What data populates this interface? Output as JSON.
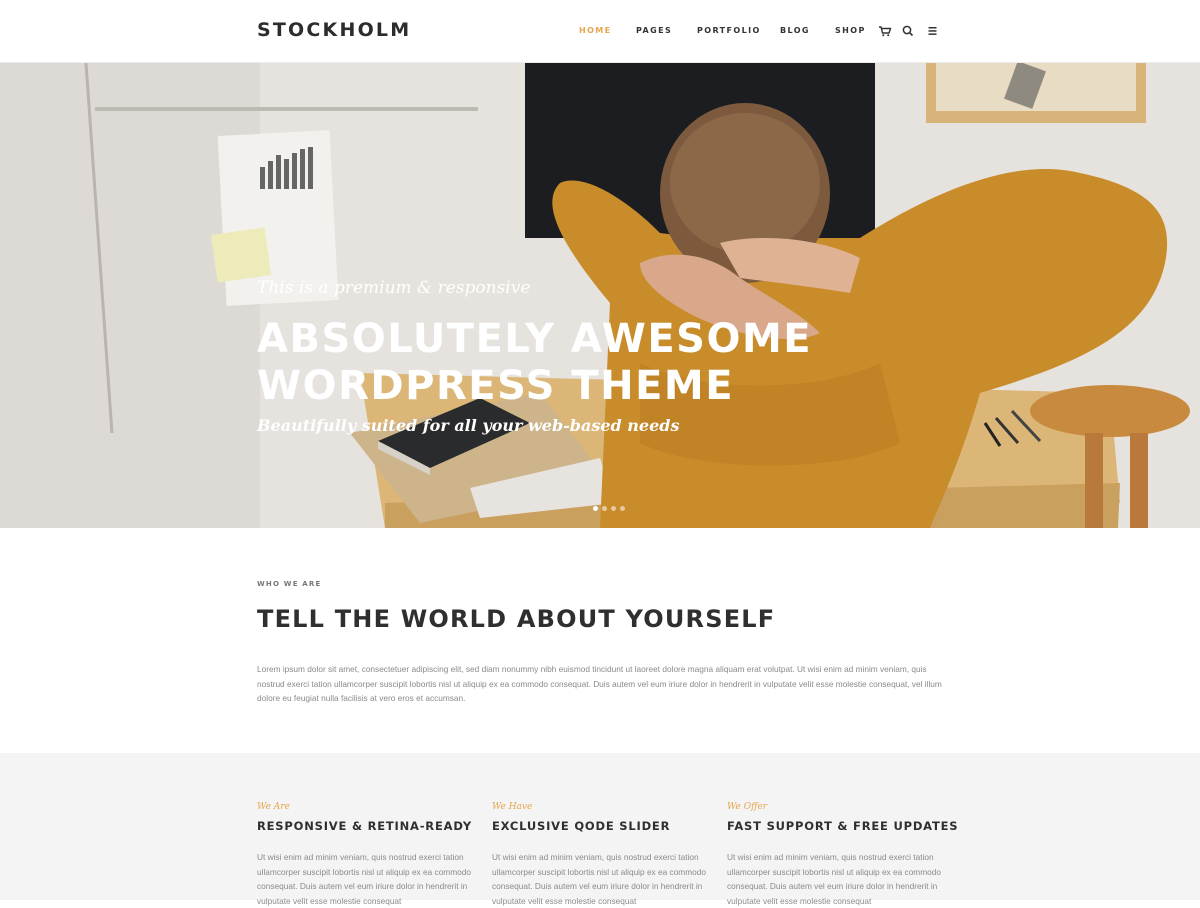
{
  "header": {
    "logo": "STOCKHOLM",
    "nav": [
      "HOME",
      "PAGES",
      "PORTFOLIO",
      "BLOG",
      "SHOP"
    ],
    "active": "HOME",
    "icons": [
      "cart-icon",
      "search-icon",
      "menu-icon"
    ]
  },
  "hero": {
    "kicker": "This is a premium & responsive",
    "title_line1": "ABSOLUTELY AWESOME",
    "title_line2": "WORDPRESS THEME",
    "subtitle": "Beautifully suited for all your web-based needs",
    "slides": 4,
    "active_slide": 1
  },
  "about": {
    "label": "WHO WE ARE",
    "title": "TELL THE WORLD ABOUT YOURSELF",
    "text": "Lorem ipsum dolor sit amet, consectetuer adipiscing elit, sed diam nonummy nibh euismod tincidunt ut laoreet dolore magna aliquam erat volutpat. Ut wisi enim ad minim veniam, quis nostrud exerci tation ullamcorper suscipit lobortis nisl ut aliquip ex ea commodo consequat. Duis autem vel eum iriure dolor in hendrerit in vulputate velit esse molestie consequat, vel illum dolore eu feugiat nulla facilisis at vero eros et accumsan."
  },
  "features": [
    {
      "kicker": "We Are",
      "title": "RESPONSIVE & RETINA-READY",
      "text": "Ut wisi enim ad minim veniam, quis nostrud exerci tation ullamcorper suscipit lobortis nisl ut aliquip ex ea commodo consequat. Duis autem vel eum iriure dolor in hendrerit in vulputate velit esse molestie consequat"
    },
    {
      "kicker": "We Have",
      "title": "EXCLUSIVE QODE SLIDER",
      "text": "Ut wisi enim ad minim veniam, quis nostrud exerci tation ullamcorper suscipit lobortis nisl ut aliquip ex ea commodo consequat. Duis autem vel eum iriure dolor in hendrerit in vulputate velit esse molestie consequat"
    },
    {
      "kicker": "We Offer",
      "title": "FAST SUPPORT & FREE UPDATES",
      "text": "Ut wisi enim ad minim veniam, quis nostrud exerci tation ullamcorper suscipit lobortis nisl ut aliquip ex ea commodo consequat. Duis autem vel eum iriure dolor in hendrerit in vulputate velit esse molestie consequat"
    }
  ],
  "colors": {
    "accent": "#e5a64d",
    "heading": "#2f2f2f",
    "body_text": "#8a8a8a",
    "features_bg": "#f4f4f4"
  }
}
